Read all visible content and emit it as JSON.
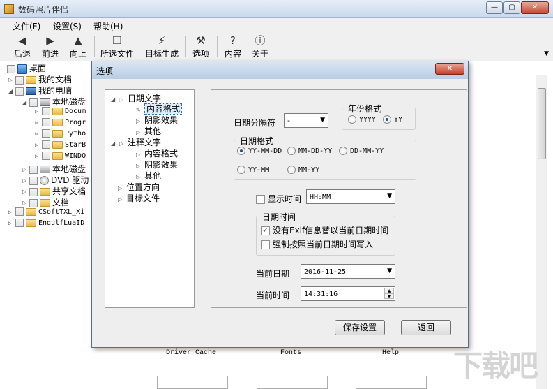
{
  "app": {
    "title": "数码照片伴侣"
  },
  "window_buttons": {
    "minimize": "—",
    "maximize": "▢",
    "close": "✕"
  },
  "menu": [
    "文件(F)",
    "设置(S)",
    "帮助(H)"
  ],
  "toolbar": {
    "back": "后退",
    "forward": "前进",
    "up": "向上",
    "selected_files": "所选文件",
    "target_generate": "目标生成",
    "options": "选项",
    "content": "内容",
    "about": "关于"
  },
  "tree": {
    "desktop": "桌面",
    "my_documents": "我的文档",
    "my_computer": "我的电脑",
    "local_disk_1": "本地磁盘",
    "folders": [
      "Docum",
      "Progr",
      "Pytho",
      "StarB",
      "WINDO"
    ],
    "local_disk_2": "本地磁盘",
    "dvd": "DVD 驱动",
    "shared_docs": "共享文档",
    "docs": "文档",
    "folder_a": "CSoftTXL_Xi",
    "folder_b": "EngulfLuaID"
  },
  "right_pane": {
    "labels": [
      "Driver Cache",
      "Fonts",
      "Help"
    ],
    "watermark": "下载吧"
  },
  "dialog": {
    "title": "选项",
    "close": "✕",
    "option_tree": {
      "date_text": "日期文字",
      "content_format": "内容格式",
      "shadow_effect": "阴影效果",
      "other": "其他",
      "note_text": "注释文字",
      "note_content_format": "内容格式",
      "note_shadow_effect": "阴影效果",
      "note_other": "其他",
      "position": "位置方向",
      "target_file": "目标文件"
    },
    "date_separator": {
      "label": "日期分隔符",
      "value": "-"
    },
    "year_format": {
      "title": "年份格式",
      "options": [
        "YYYY",
        "YY"
      ],
      "selected": "YY"
    },
    "date_format": {
      "title": "日期格式",
      "options": [
        "YY-MM-DD",
        "MM-DD-YY",
        "DD-MM-YY",
        "YY-MM",
        "MM-YY"
      ],
      "selected": "YY-MM-DD"
    },
    "show_time": {
      "label": "显示时间",
      "checked": false,
      "value": "HH:MM"
    },
    "date_time": {
      "title": "日期时间",
      "no_exif": {
        "label": "没有Exif信息替以当前日期时间",
        "checked": true
      },
      "force_current": {
        "label": "强制按照当前日期时间写入",
        "checked": false
      }
    },
    "current_date": {
      "label": "当前日期",
      "value": "2016-11-25"
    },
    "current_time": {
      "label": "当前时间",
      "value": "14:31:16"
    },
    "save_button": "保存设置",
    "back_button": "返回"
  }
}
